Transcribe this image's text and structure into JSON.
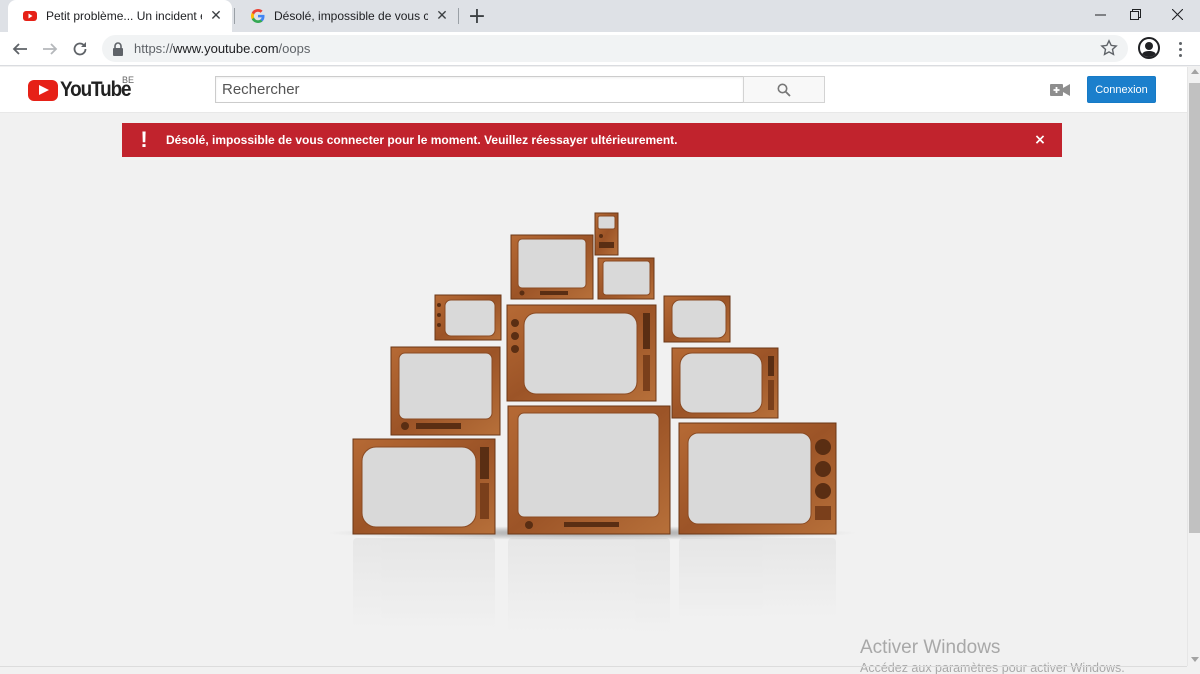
{
  "browser": {
    "tabs": [
      {
        "title": "Petit problème... Un incident est",
        "favicon": "youtube-icon",
        "active": true
      },
      {
        "title": "Désolé, impossible de vous conn",
        "favicon": "google-icon",
        "active": false
      }
    ],
    "url": {
      "scheme": "https://",
      "host": "www.youtube.com",
      "path": "/oops"
    },
    "icons": [
      "back-arrow-icon",
      "forward-arrow-icon",
      "reload-icon",
      "lock-icon",
      "star-icon",
      "profile-avatar-icon",
      "menu-dots-icon"
    ]
  },
  "youtube": {
    "logo_text": "YouTube",
    "country": "BE",
    "search_placeholder": "Rechercher",
    "signin_label": "Connexion",
    "alert": {
      "icon": "!",
      "message": "Désolé, impossible de vous connecter pour le moment. Veuillez réessayer ultérieurement.",
      "close": "×"
    },
    "colors": {
      "brand_red": "#e62117",
      "alert_red": "#c1232d",
      "signin_blue": "#1b7fcc",
      "tv_wood": "#a0582a"
    }
  },
  "watermark": {
    "title": "Activer Windows",
    "subtitle": "Accédez aux paramètres pour activer Windows."
  }
}
